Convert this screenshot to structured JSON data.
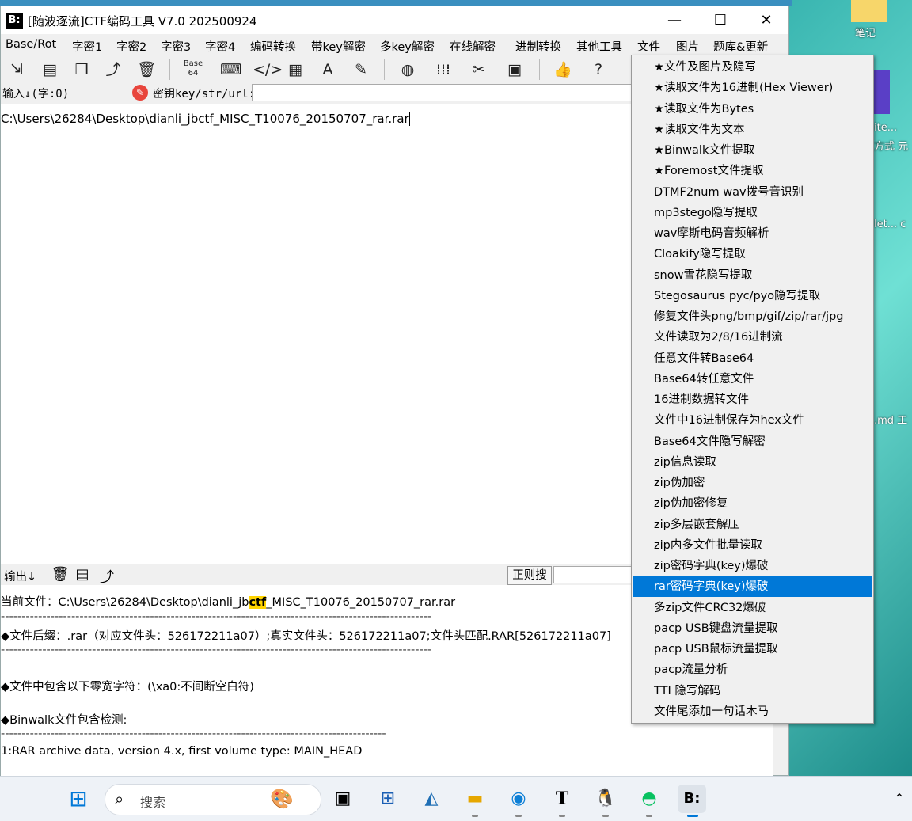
{
  "window": {
    "title": "[随波逐流]CTF编码工具 V7.0  202500924",
    "logo": "B:"
  },
  "window_controls": {
    "minimize": "—",
    "maximize": "☐",
    "close": "✕"
  },
  "menubar": [
    "Base/Rot",
    "字密1",
    "字密2",
    "字密3",
    "字密4",
    "编码转换",
    "带key解密",
    "多key解密",
    "在线解密",
    "进制转换",
    "其他工具",
    "文件",
    "图片",
    "题库&更新"
  ],
  "input": {
    "label": "输入↓(字:0)",
    "key_label": "密钥key/str/url:",
    "text": "C:\\Users\\26284\\Desktop\\dianli_jbctf_MISC_T10076_20150707_rar.rar"
  },
  "output": {
    "label": "输出↓",
    "regex_button": "正则搜",
    "lines": {
      "current_file_prefix": "当前文件：C:\\Users\\26284\\Desktop\\dianli_jb",
      "current_file_hl": "ctf",
      "current_file_suffix": "_MISC_T10076_20150707_rar.rar",
      "sep1": "--------------------------------------------------------------------------------------------------------",
      "suffix_info": "◆文件后缀：.rar（对应文件头：526172211a07）;真实文件头：526172211a07;文件头匹配.RAR[526172211a07]",
      "sep2": "--------------------------------------------------------------------------------------------------------",
      "zero_width": "◆文件中包含以下零宽字符：(\\xa0:不间断空白符)",
      "binwalk": "◆Binwalk文件包含检测:",
      "sep3": "---------------------------------------------------------------------------------------------",
      "binwalk_result": "1:RAR archive data, version 4.x, first volume type: MAIN_HEAD"
    }
  },
  "dropdown": {
    "selected_index": 25,
    "items": [
      "★文件及图片及隐写",
      "★读取文件为16进制(Hex Viewer)",
      "★读取文件为Bytes",
      "★读取文件为文本",
      "★Binwalk文件提取",
      "★Foremost文件提取",
      "DTMF2num  wav拨号音识别",
      "mp3stego隐写提取",
      "wav摩斯电码音频解析",
      "Cloakify隐写提取",
      "snow雪花隐写提取",
      "Stegosaurus pyc/pyo隐写提取",
      "修复文件头png/bmp/gif/zip/rar/jpg",
      "文件读取为2/8/16进制流",
      "任意文件转Base64",
      "Base64转任意文件",
      "16进制数据转文件",
      "文件中16进制保存为hex文件",
      "Base64文件隐写解密",
      "zip信息读取",
      "zip伪加密",
      "zip伪加密修复",
      "zip多层嵌套解压",
      "zip内多文件批量读取",
      "zip密码字典(key)爆破",
      "rar密码字典(key)爆破",
      "多zip文件CRC32爆破",
      "pacp USB键盘流量提取",
      "pacp USB鼠标流量提取",
      "pacp流量分析",
      "TTI 隐写解码",
      "文件尾添加一句话木马"
    ]
  },
  "desktop": {
    "notes_label": "笔记",
    "fragments": [
      "ite...",
      "方式  元",
      "let...  c",
      ".md  ⼯"
    ]
  },
  "taskbar": {
    "search_placeholder": "搜索"
  },
  "colors": {
    "accent": "#0078d7",
    "highlight": "#ffd400",
    "desktop": "#2fb9b2"
  }
}
